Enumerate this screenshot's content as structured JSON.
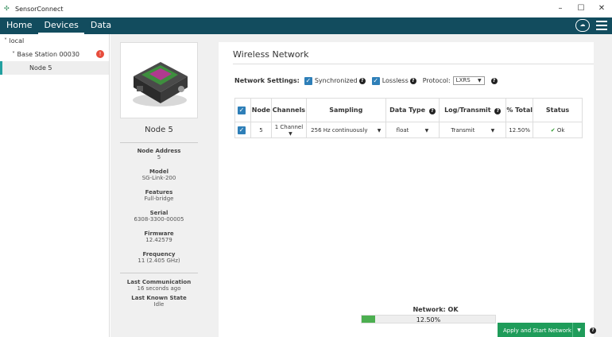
{
  "window": {
    "title": "SensorConnect",
    "minimize": "–",
    "maximize": "☐",
    "close": "✕"
  },
  "nav": {
    "tabs": [
      "Home",
      "Devices",
      "Data"
    ],
    "active": "Devices"
  },
  "tree": {
    "root": "local",
    "base_station": "Base Station 00030",
    "badge": "!",
    "node": "Node 5"
  },
  "device": {
    "name": "Node 5",
    "props": [
      {
        "k": "Node Address",
        "v": "5"
      },
      {
        "k": "Model",
        "v": "SG-Link-200"
      },
      {
        "k": "Features",
        "v": "Full-bridge"
      },
      {
        "k": "Serial",
        "v": "6308-3300-00005"
      },
      {
        "k": "Firmware",
        "v": "12.42579"
      },
      {
        "k": "Frequency",
        "v": "11 (2.405 GHz)"
      }
    ],
    "last_comm_label": "Last Communication",
    "last_comm_value": "16 seconds ago",
    "last_state_label": "Last Known State",
    "last_state_value": "Idle"
  },
  "network": {
    "title": "Wireless Network",
    "settings_label": "Network Settings:",
    "synchronized": "Synchronized",
    "lossless": "Lossless",
    "protocol_label": "Protocol:",
    "protocol_value": "LXRS",
    "columns": [
      "Node",
      "Channels",
      "Sampling",
      "Data Type",
      "Log/Transmit",
      "% Total",
      "Status"
    ],
    "rows": [
      {
        "node": "5",
        "channels": "1 Channel",
        "sampling": "256 Hz continuously",
        "data_type": "float",
        "log_transmit": "Transmit",
        "total": "12.50%",
        "status": "Ok"
      }
    ],
    "status_label": "Network: OK",
    "progress_text": "12.50%",
    "progress_value": 0.125,
    "apply_label": "Apply and Start Network"
  },
  "colors": {
    "nav": "#124c5e",
    "accent": "#2e7fb8",
    "ok": "#2e9c2e",
    "apply": "#1f9c5a"
  }
}
